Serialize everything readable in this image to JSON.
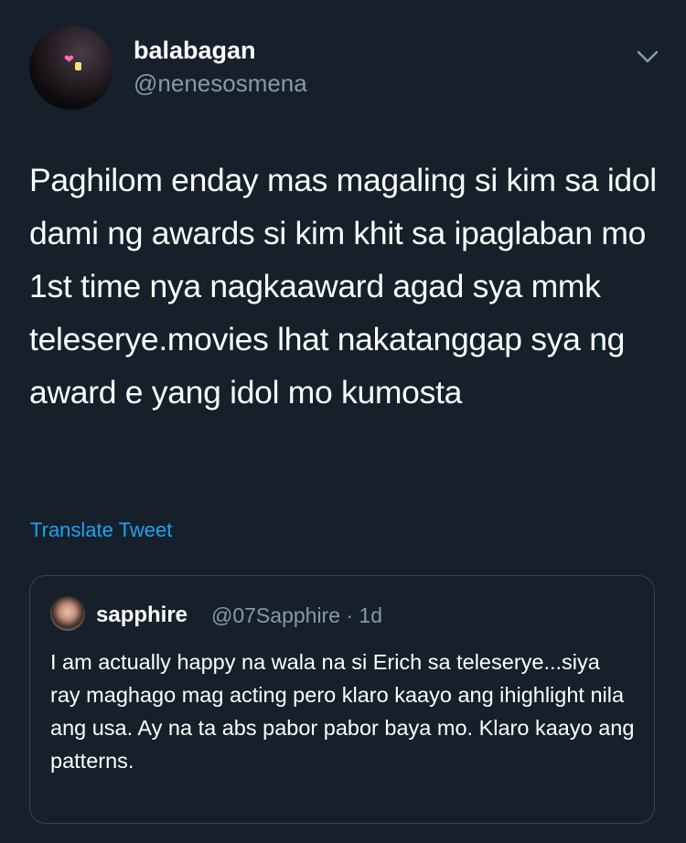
{
  "tweet": {
    "display_name": "balabagan",
    "handle": "@nenesosmena",
    "text": "Paghilom enday mas magaling si kim sa idol dami ng awards si kim khit sa ipaglaban mo 1st time nya nagkaaward agad sya mmk teleserye.movies lhat nakatanggap sya ng award e yang idol mo kumosta",
    "translate_label": "Translate Tweet",
    "avatar_icon": "profile-photo-icon",
    "menu_icon": "chevron-down-icon"
  },
  "quoted_tweet": {
    "display_name": "sapphire",
    "meta": "@07Sapphire · 1d",
    "text": "I am actually happy na wala na si Erich sa teleserye...siya ray maghago mag acting pero klaro kaayo ang ihighlight nila ang usa. Ay na ta abs pabor pabor baya mo. Klaro kaayo ang patterns."
  },
  "colors": {
    "background": "#15202b",
    "primary_text": "#ffffff",
    "secondary_text": "#8899a6",
    "link": "#1da1f2",
    "border": "#38444d"
  }
}
